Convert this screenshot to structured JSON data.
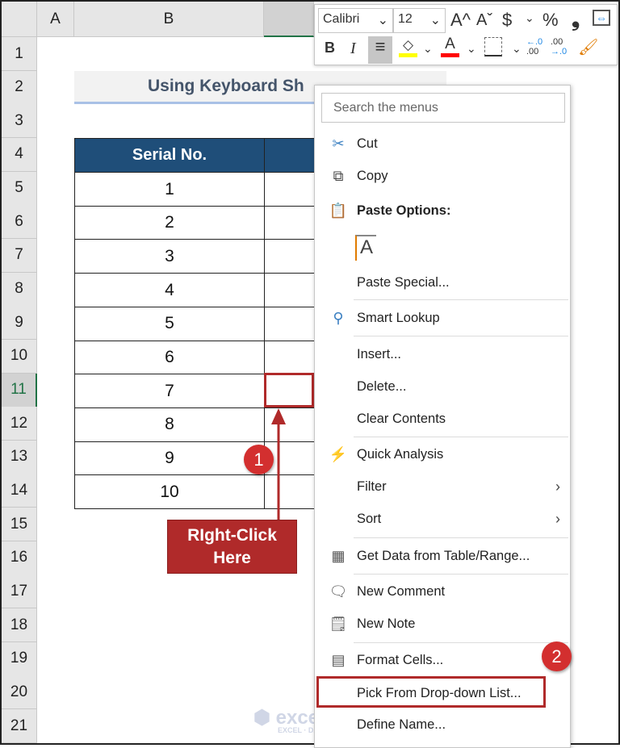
{
  "columns": [
    "A",
    "B"
  ],
  "rows": [
    "1",
    "2",
    "3",
    "4",
    "5",
    "6",
    "7",
    "8",
    "9",
    "10",
    "11",
    "12",
    "13",
    "14",
    "15",
    "16",
    "17",
    "18",
    "19",
    "20",
    "21"
  ],
  "selected_row": "11",
  "title": "Using Keyboard Sh",
  "table": {
    "header": "Serial No.",
    "values": [
      "1",
      "2",
      "3",
      "4",
      "5",
      "6",
      "7",
      "8",
      "9",
      "10"
    ]
  },
  "mini_toolbar": {
    "font": "Calibri",
    "size": "12",
    "buttons": [
      "A^",
      "Aˇ",
      "$",
      "%",
      "❟",
      "⇔"
    ],
    "bold": "B",
    "italic": "I",
    "fill_color": "#ffff00",
    "font_color": "#ff0000"
  },
  "menu": {
    "search_placeholder": "Search the menus",
    "items": [
      {
        "label": "Cut",
        "icon": "scissors-icon",
        "glyph": "✂",
        "color": "#3a7fc1"
      },
      {
        "label": "Copy",
        "icon": "copy-icon",
        "glyph": "⧉",
        "color": "#444"
      },
      {
        "label": "Paste Options:",
        "icon": "paste-icon",
        "glyph": "📋",
        "bold": true,
        "color": "#e07b00"
      },
      {
        "label": "",
        "icon": "paste-keep-text-icon",
        "glyph": "A",
        "color": "#444"
      },
      {
        "label": "Paste Special...",
        "icon": "",
        "glyph": ""
      },
      {
        "label": "Smart Lookup",
        "icon": "smart-lookup-icon",
        "glyph": "⚲",
        "color": "#3a7fc1"
      },
      {
        "label": "Insert...",
        "icon": "",
        "glyph": ""
      },
      {
        "label": "Delete...",
        "icon": "",
        "glyph": ""
      },
      {
        "label": "Clear Contents",
        "icon": "",
        "glyph": ""
      },
      {
        "label": "Quick Analysis",
        "icon": "quick-analysis-icon",
        "glyph": "⚡",
        "color": "#e07b00"
      },
      {
        "label": "Filter",
        "icon": "",
        "glyph": "",
        "submenu": true
      },
      {
        "label": "Sort",
        "icon": "",
        "glyph": "",
        "submenu": true
      },
      {
        "label": "Get Data from Table/Range...",
        "icon": "table-icon",
        "glyph": "▦",
        "color": "#555"
      },
      {
        "label": "New Comment",
        "icon": "new-comment-icon",
        "glyph": "🗨",
        "color": "#555"
      },
      {
        "label": "New Note",
        "icon": "new-note-icon",
        "glyph": "🗒",
        "color": "#555"
      },
      {
        "label": "Format Cells...",
        "icon": "format-cells-icon",
        "glyph": "▤",
        "color": "#555"
      },
      {
        "label": "Pick From Drop-down List...",
        "icon": "",
        "glyph": ""
      },
      {
        "label": "Define Name...",
        "icon": "",
        "glyph": ""
      }
    ]
  },
  "callout": {
    "text": "RIght-Click Here",
    "step1": "1",
    "step2": "2",
    "color": "#b02a2a"
  },
  "watermark": {
    "name": "exceldemy",
    "tagline": "EXCEL · DATA · BI"
  }
}
